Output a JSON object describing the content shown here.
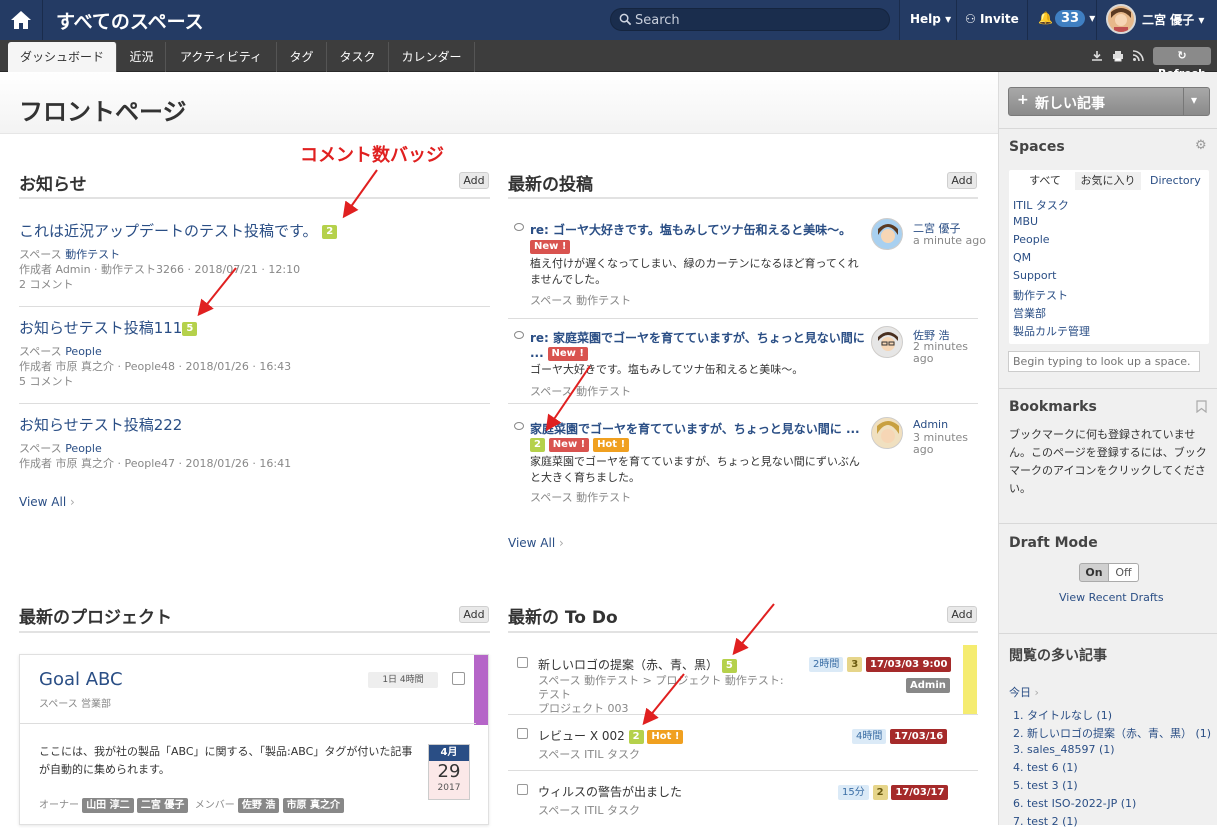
{
  "topbar": {
    "title": "すべてのスペース",
    "search_placeholder": "Search",
    "help": "Help ▾",
    "invite": "Invite",
    "notifications": "33",
    "user": "二宮 優子 ▾"
  },
  "tabs": [
    "ダッシュボード",
    "近況",
    "アクティビティ",
    "タグ",
    "タスク",
    "カレンダー"
  ],
  "toolbar": {
    "refresh": "Refresh"
  },
  "page": {
    "title": "フロントページ"
  },
  "annotation": "コメント数バッジ",
  "notices": {
    "title": "お知らせ",
    "add": "Add",
    "items": [
      {
        "title": "これは近況アップデートのテスト投稿です。",
        "count": "2",
        "space_label": "スペース",
        "space": "動作テスト",
        "meta": "作成者 Admin · 動作テスト3266 · 2018/07/21 · 12:10",
        "comments": "2 コメント"
      },
      {
        "title": "お知らせテスト投稿111",
        "count": "5",
        "space_label": "スペース",
        "space": "People",
        "meta": "作成者 市原 真之介 · People48 · 2018/01/26 · 16:43",
        "comments": "5 コメント"
      },
      {
        "title": "お知らせテスト投稿222",
        "count": "",
        "space_label": "スペース",
        "space": "People",
        "meta": "作成者 市原 真之介 · People47 · 2018/01/26 · 16:41",
        "comments": ""
      }
    ],
    "view_all": "View All"
  },
  "recent": {
    "title": "最新の投稿",
    "add": "Add",
    "items": [
      {
        "title": "re: ゴーヤ大好きです。塩もみしてツナ缶和えると美味〜。",
        "badges": [
          "New !"
        ],
        "body": "植え付けが遅くなってしまい、緑のカーテンになるほど育ってくれませんでした。",
        "space": "スペース 動作テスト",
        "author": "二宮 優子",
        "time": "a minute ago"
      },
      {
        "title": "re: 家庭菜園でゴーヤを育てていますが、ちょっと見ない間に",
        "title2": "...",
        "badges": [
          "New !"
        ],
        "body": "ゴーヤ大好きです。塩もみしてツナ缶和えると美味〜。",
        "space": "スペース 動作テスト",
        "author": "佐野 浩",
        "time": "2 minutes ago"
      },
      {
        "title": "家庭菜園でゴーヤを育てていますが、ちょっと見ない間に ...",
        "count": "2",
        "badges": [
          "New !",
          "Hot !"
        ],
        "body": "家庭菜園でゴーヤを育てていますが、ちょっと見ない間にずいぶんと大きく育ちました。",
        "space": "スペース 動作テスト",
        "author": "Admin",
        "time": "3 minutes ago"
      }
    ],
    "view_all": "View All"
  },
  "projects": {
    "title": "最新のプロジェクト",
    "add": "Add",
    "card": {
      "name": "Goal ABC",
      "space": "スペース 営業部",
      "progress": "1日 4時間",
      "desc": "ここには、我が社の製品「ABC」に関する、「製品:ABC」タグが付いた記事が自動的に集められます。",
      "owner_label": "オーナー",
      "owners": [
        "山田 淳二",
        "二宮 優子"
      ],
      "member_label": "メンバー",
      "members": [
        "佐野 浩",
        "市原 真之介"
      ],
      "date_month": "4月",
      "date_day": "29",
      "date_year": "2017"
    }
  },
  "todos": {
    "title": "最新の To Do",
    "add": "Add",
    "items": [
      {
        "title": "新しいロゴの提案（赤、青、黒）",
        "count": "5",
        "sub": "スペース 動作テスト > プロジェクト 動作テスト: テスト",
        "sub2": "プロジェクト 003",
        "dur": "2時間",
        "n": "3",
        "date": "17/03/03 9:00",
        "user": "Admin"
      },
      {
        "title": "レビュー X 002",
        "count": "2",
        "hot": "Hot !",
        "sub": "スペース ITIL タスク",
        "dur": "4時間",
        "date": "17/03/16"
      },
      {
        "title": "ウィルスの警告が出ました",
        "sub": "スペース ITIL タスク",
        "dur": "15分",
        "n": "2",
        "date": "17/03/17"
      }
    ]
  },
  "sidebar": {
    "new_article": "新しい記事",
    "spaces_title": "Spaces",
    "space_tabs": [
      "すべて",
      "お気に入り",
      "Directory"
    ],
    "spaces": [
      "ITIL タスク",
      "MBU",
      "People",
      "QM",
      "Support",
      "動作テスト",
      "営業部",
      "製品カルテ管理"
    ],
    "space_lookup_placeholder": "Begin typing to look up a space.",
    "bookmarks_title": "Bookmarks",
    "bookmarks_text": "ブックマークに何も登録されていません。このページを登録するには、ブックマークのアイコンをクリックしてください。",
    "draft_title": "Draft Mode",
    "draft_on": "On",
    "draft_off": "Off",
    "view_drafts": "View Recent Drafts",
    "popular_title": "閲覧の多い記事",
    "popular_period": "今日",
    "popular": [
      "1. タイトルなし (1)",
      "2. 新しいロゴの提案（赤、青、黒） (1)",
      "3. sales_48597 (1)",
      "4. test 6 (1)",
      "5. test 3 (1)",
      "6. test ISO-2022-JP (1)",
      "7. test 2 (1)"
    ]
  }
}
